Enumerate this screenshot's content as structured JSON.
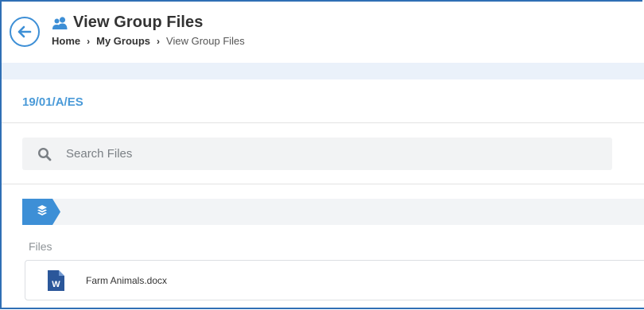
{
  "header": {
    "title": "View Group Files",
    "breadcrumb": [
      "Home",
      "My Groups",
      "View Group Files"
    ]
  },
  "group": {
    "code": "19/01/A/ES"
  },
  "search": {
    "placeholder": "Search Files",
    "value": ""
  },
  "files_section": {
    "label": "Files",
    "items": [
      {
        "name": "Farm Animals.docx",
        "type_icon": "word-doc-icon"
      }
    ]
  },
  "colors": {
    "accent": "#4a9ad8",
    "frame": "#2f6fb5",
    "word": "#2b579a"
  }
}
